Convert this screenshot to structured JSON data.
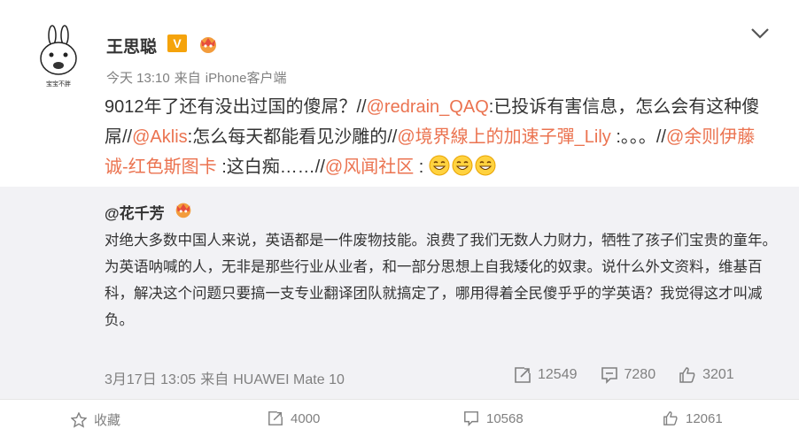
{
  "post": {
    "author": "王思聪",
    "verified_mark": "V",
    "time": "今天 13:10",
    "source_prefix": "来自",
    "source": "iPhone客户端",
    "avatar_caption": "宝宝不胖",
    "text": {
      "p1": "9012年了还有没出过国的傻屌？//",
      "m1": "@redrain_QAQ",
      "p2": ":已投诉有害信息，怎么会有这种傻屌//",
      "m2": "@Aklis",
      "p3": ":怎么每天都能看见沙雕的//",
      "m3": "@境界線上的加速子彈_Lily",
      "p4": " :。。。//",
      "m4": "@余则伊藤诚-红色斯图卡",
      "p5": " :这白痴……//",
      "m5": "@风闻社区",
      "p6": " : "
    }
  },
  "repost": {
    "author": "@花千芳",
    "paragraph1": "对绝大多数中国人来说，英语都是一件废物技能。浪费了我们无数人力财力，牺牲了孩子们宝贵的童年。",
    "paragraph2": "为英语呐喊的人，无非是那些行业从业者，和一部分思想上自我矮化的奴隶。说什么外文资料，维基百科，解决这个问题只要搞一支专业翻译团队就搞定了，哪用得着全民傻乎乎的学英语？我觉得这才叫减负。",
    "time": "3月17日 13:05",
    "source_prefix": "来自",
    "source": "HUAWEI Mate 10",
    "reposts": "12549",
    "comments": "7280",
    "likes": "3201"
  },
  "bottom_bar": {
    "favorite": "收藏",
    "repost": "4000",
    "comment": "10568",
    "like": "12061"
  },
  "colors": {
    "mention": "#eb7350",
    "meta": "#808080",
    "repost_bg": "#f2f2f5",
    "vip_badge": "#f5a30b"
  },
  "icons": [
    "avatar-image",
    "verified-v-icon",
    "member-crown-icon",
    "chevron-down-icon",
    "grin-emoji-icon",
    "repost-icon",
    "comment-icon",
    "like-icon",
    "favorite-icon"
  ]
}
